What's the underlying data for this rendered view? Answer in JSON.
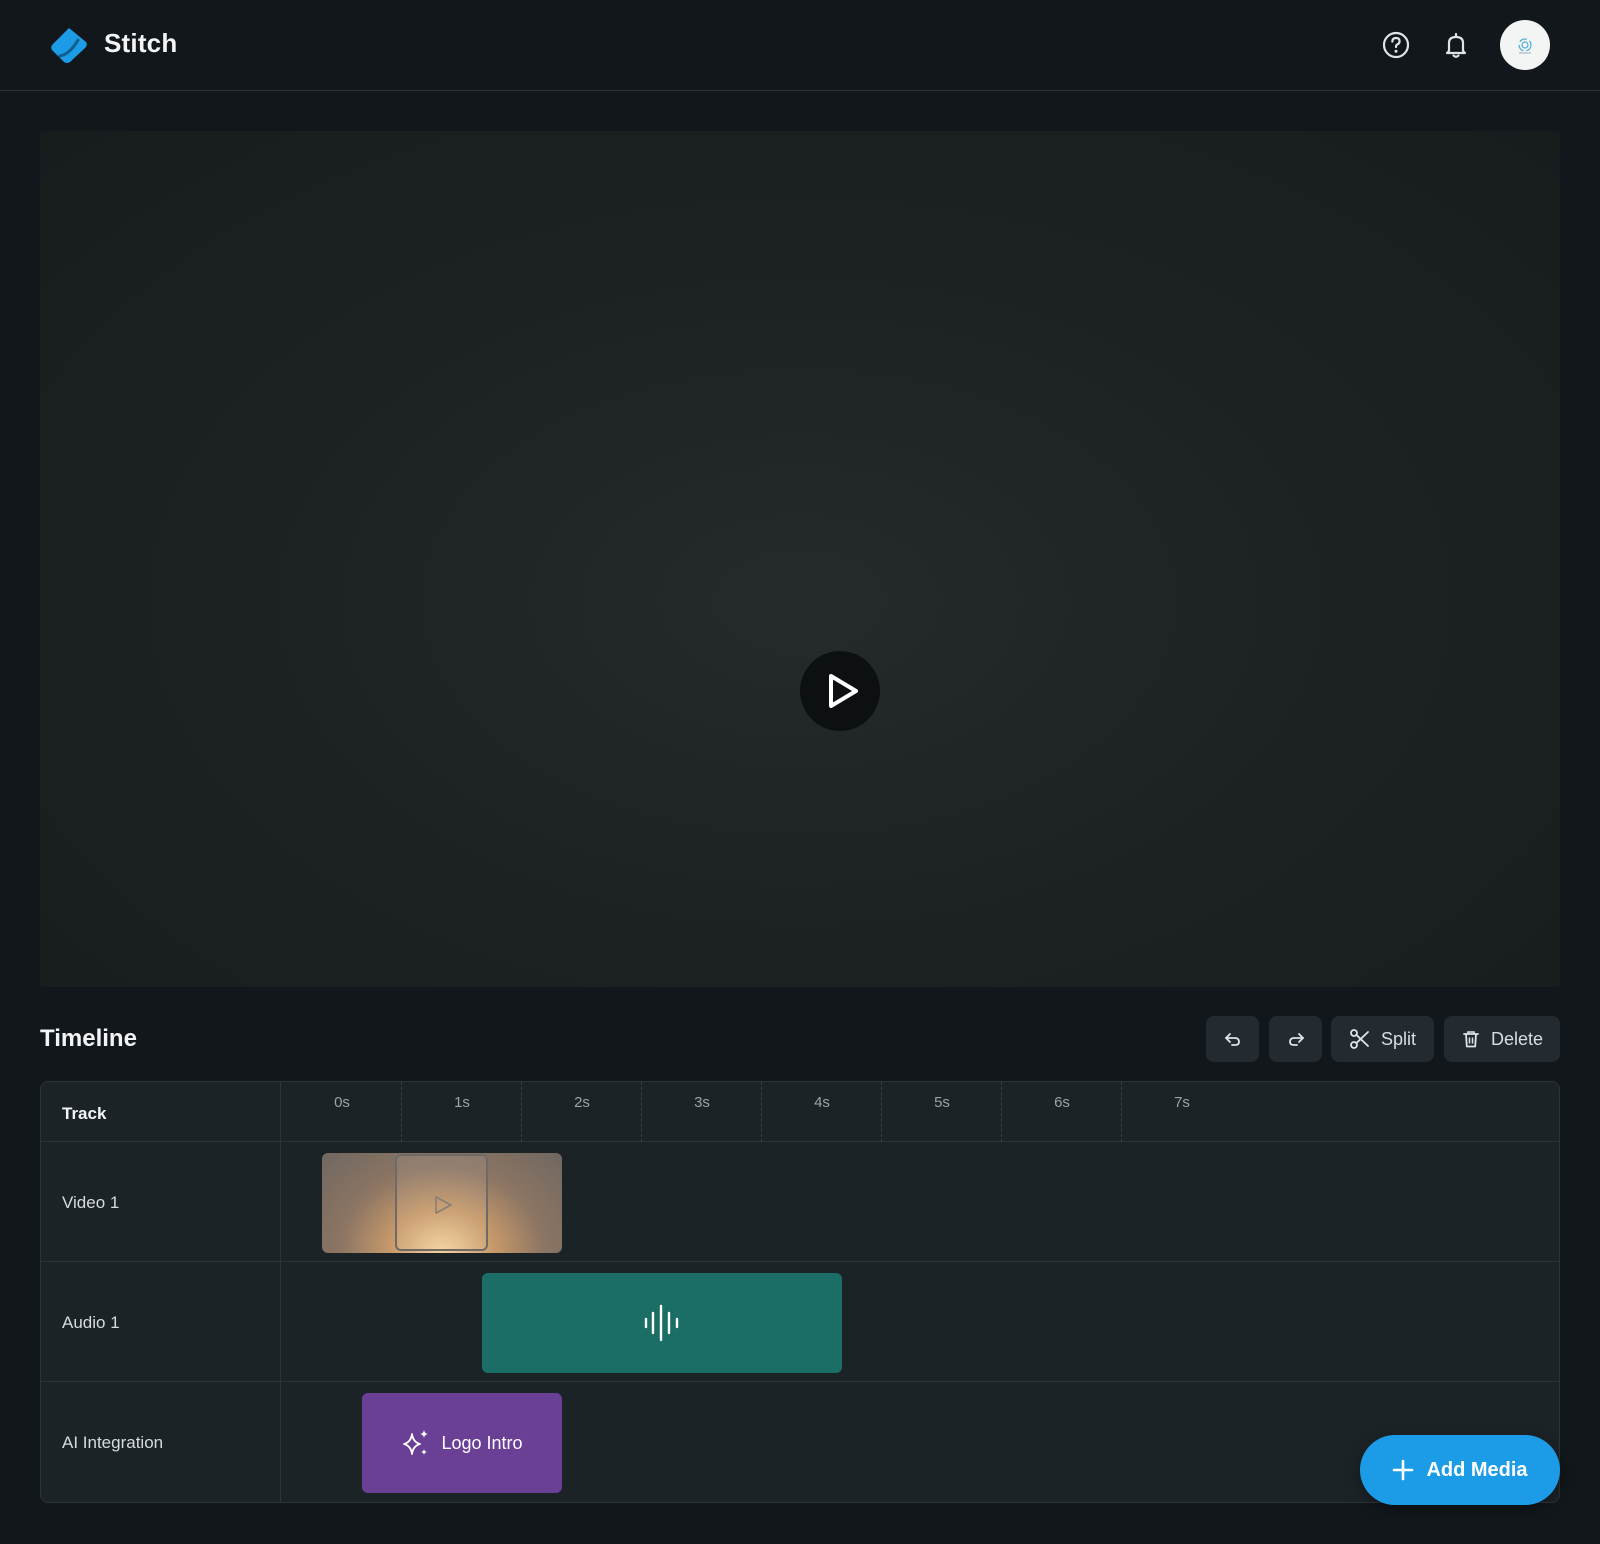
{
  "app": {
    "brand": "Stitch"
  },
  "header": {
    "icons": [
      "help-icon",
      "bell-icon",
      "avatar"
    ]
  },
  "timeline": {
    "title": "Timeline",
    "toolbar": {
      "undo_icon": "undo-icon",
      "redo_icon": "redo-icon",
      "split_label": "Split",
      "delete_label": "Delete"
    },
    "track_header": "Track",
    "ticks": [
      "0s",
      "1s",
      "2s",
      "3s",
      "4s",
      "5s",
      "6s",
      "7s"
    ],
    "tracks": [
      {
        "name": "Video 1"
      },
      {
        "name": "Audio 1"
      },
      {
        "name": "AI Integration"
      }
    ],
    "clips": {
      "ai_clip_label": "Logo Intro"
    }
  },
  "actions": {
    "add_media_label": "Add Media"
  },
  "colors": {
    "accent": "#1c9ce6",
    "audio_clip": "#1b6e66",
    "ai_clip": "#6a3f96",
    "background": "#12171b"
  }
}
